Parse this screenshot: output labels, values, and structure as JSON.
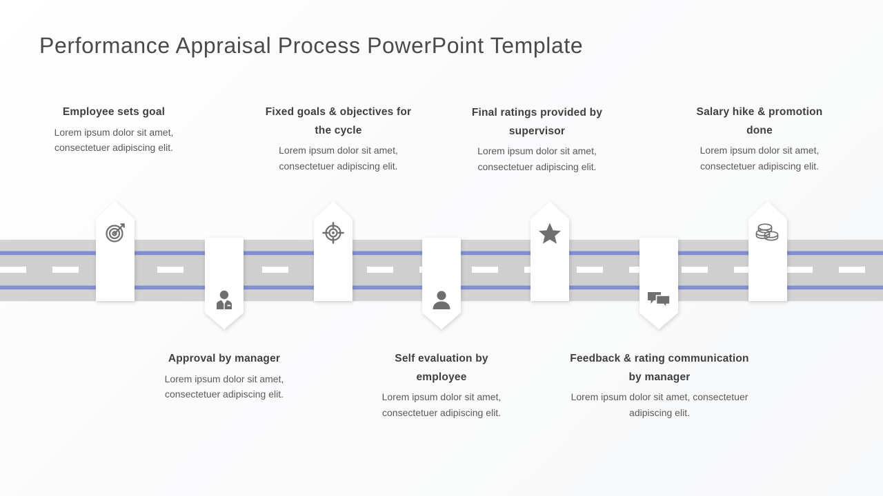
{
  "slide": {
    "title": "Performance Appraisal Process PowerPoint Template",
    "background_color": "#f7f8f9"
  },
  "road": {
    "band_color": "#d3d3d3",
    "line_color": "#7e90d0",
    "dash_color": "#ffffff"
  },
  "marker_color": "#ffffff",
  "icon_color": "#6f6f6f",
  "steps": [
    {
      "index": 1,
      "position": "top",
      "icon": "target-arrow-icon",
      "heading": "Employee sets goal",
      "body": "Lorem ipsum dolor sit amet, consectetuer adipiscing elit."
    },
    {
      "index": 2,
      "position": "bottom",
      "icon": "businessman-icon",
      "heading": "Approval by manager",
      "body": "Lorem ipsum dolor sit amet, consectetuer adipiscing elit."
    },
    {
      "index": 3,
      "position": "top",
      "icon": "crosshair-icon",
      "heading": "Fixed goals & objectives for the cycle",
      "body": "Lorem ipsum dolor sit amet, consectetuer adipiscing elit."
    },
    {
      "index": 4,
      "position": "bottom",
      "icon": "user-icon",
      "heading": "Self evaluation by employee",
      "body": "Lorem ipsum dolor sit amet, consectetuer adipiscing elit."
    },
    {
      "index": 5,
      "position": "top",
      "icon": "star-icon",
      "heading": "Final ratings provided by supervisor",
      "body": "Lorem ipsum dolor sit amet, consectetuer adipiscing elit."
    },
    {
      "index": 6,
      "position": "bottom",
      "icon": "speech-bubbles-icon",
      "heading": "Feedback & rating communication by manager",
      "body": "Lorem ipsum dolor sit amet, consectetuer adipiscing elit."
    },
    {
      "index": 7,
      "position": "top",
      "icon": "coins-icon",
      "heading": "Salary hike & promotion done",
      "body": "Lorem ipsum dolor sit amet, consectetuer adipiscing elit."
    }
  ]
}
